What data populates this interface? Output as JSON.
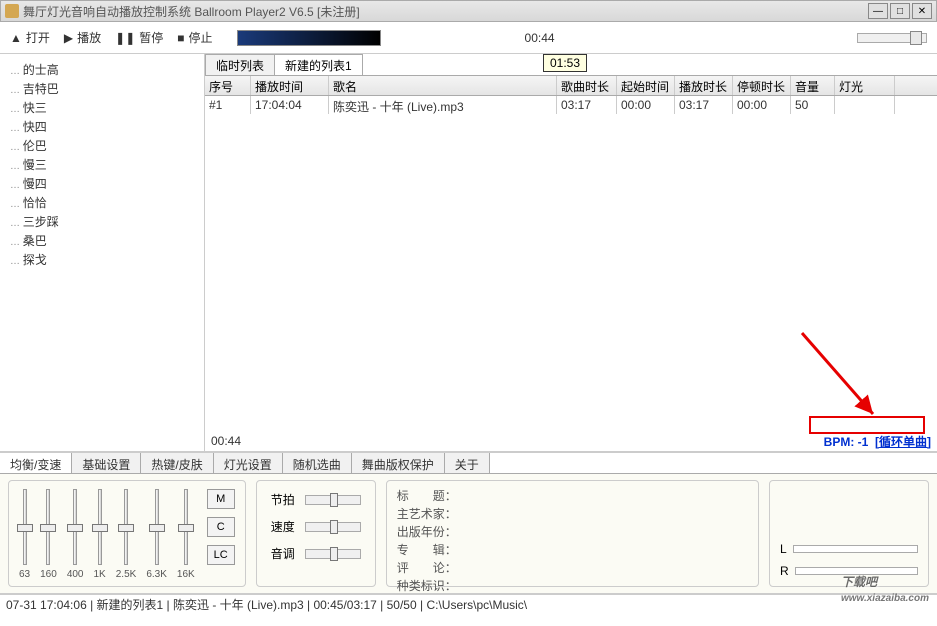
{
  "window": {
    "title": "舞厅灯光音响自动播放控制系统 Ballroom Player2 V6.5 [未注册]"
  },
  "toolbar": {
    "open": "打开",
    "play": "播放",
    "pause": "暂停",
    "stop": "停止",
    "time": "00:44"
  },
  "sidebar": {
    "items": [
      "的士高",
      "吉特巴",
      "快三",
      "快四",
      "伦巴",
      "慢三",
      "慢四",
      "恰恰",
      "三步踩",
      "桑巴",
      "探戈"
    ]
  },
  "tabs": {
    "temp": "临时列表",
    "new1": "新建的列表1",
    "tooltip": "01:53"
  },
  "columns": {
    "c0": "序号",
    "c1": "播放时间",
    "c2": "歌名",
    "c3": "歌曲时长",
    "c4": "起始时间",
    "c5": "播放时长",
    "c6": "停顿时长",
    "c7": "音量",
    "c8": "灯光"
  },
  "rows": [
    {
      "c0": "#1",
      "c1": "17:04:04",
      "c2": "陈奕迅 - 十年 (Live).mp3",
      "c3": "03:17",
      "c4": "00:00",
      "c5": "03:17",
      "c6": "00:00",
      "c7": "50",
      "c8": ""
    }
  ],
  "timerow": {
    "current": "00:44",
    "bpm_label": "BPM: -1",
    "loop": "[循环单曲]"
  },
  "btabs": [
    "均衡/变速",
    "基础设置",
    "热键/皮肤",
    "灯光设置",
    "随机选曲",
    "舞曲版权保护",
    "关于"
  ],
  "eq": {
    "bands": [
      "63",
      "160",
      "400",
      "1K",
      "2.5K",
      "6.3K",
      "16K"
    ],
    "btns": {
      "m": "M",
      "c": "C",
      "lc": "LC"
    }
  },
  "mid": {
    "beat": "节拍",
    "speed": "速度",
    "tone": "音调"
  },
  "meta": {
    "keys": [
      "标　　题：",
      "主艺术家：",
      "出版年份：",
      "专　　辑：",
      "评　　论：",
      "种类标识："
    ]
  },
  "lr": {
    "l": "L",
    "r": "R"
  },
  "status": "07-31 17:04:06 | 新建的列表1 | 陈奕迅 - 十年 (Live).mp3 | 00:45/03:17 | 50/50 | C:\\Users\\pc\\Music\\",
  "watermark": {
    "main": "下载吧",
    "sub": "www.xiazaiba.com"
  }
}
